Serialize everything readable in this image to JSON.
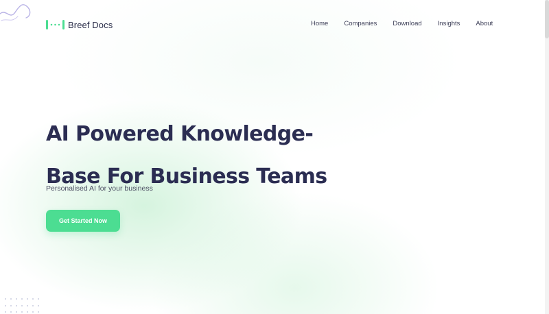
{
  "brand": {
    "name": "Breef Docs",
    "accent": "#4cdd92",
    "logo_icon": "document-bracket-dots-icon"
  },
  "nav": {
    "items": [
      {
        "label": "Home"
      },
      {
        "label": "Companies"
      },
      {
        "label": "Download"
      },
      {
        "label": "Insights"
      },
      {
        "label": "About"
      }
    ]
  },
  "hero": {
    "title_line1": "AI Powered Knowledge-",
    "title_line2": "Base For Business Teams",
    "subtitle": "Personalised AI for your business",
    "cta_label": "Get Started Now"
  },
  "colors": {
    "heading": "#2b2d52",
    "text": "#4b4d62",
    "cta_bg": "#4cdd92"
  }
}
